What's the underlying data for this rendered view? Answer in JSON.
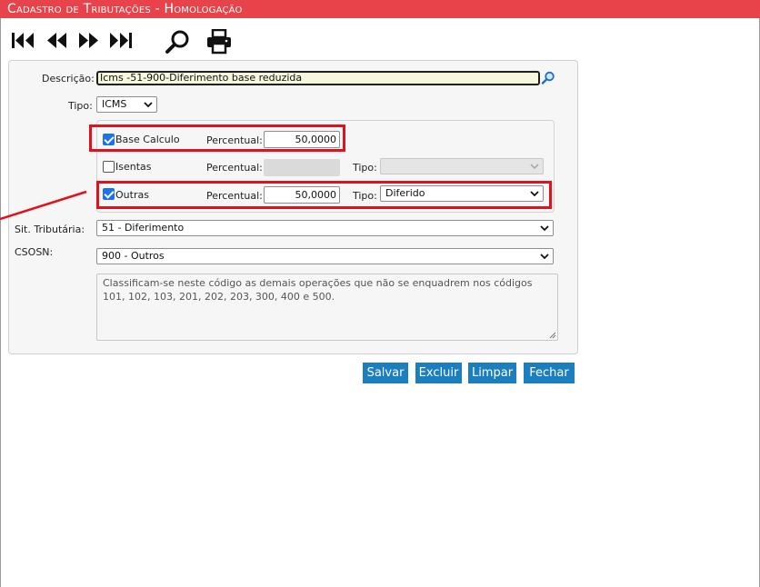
{
  "window": {
    "title": "Cadastro de Tributações  - Homologação"
  },
  "toolbar": {
    "first_icon": "first-record-icon",
    "prev_icon": "previous-record-icon",
    "next_icon": "next-record-icon",
    "last_icon": "last-record-icon",
    "search_icon": "search-icon",
    "print_icon": "print-icon"
  },
  "form": {
    "descricao_label": "Descrição:",
    "descricao_value": "Icms -51-900-Diferimento base reduzida",
    "tipo_label": "Tipo:",
    "tipo_value": "ICMS",
    "base_calculo": {
      "label": "Base Calculo",
      "checked": true,
      "percentual_label": "Percentual:",
      "percentual_value": "50,0000"
    },
    "isentas": {
      "label": "Isentas",
      "checked": false,
      "percentual_label": "Percentual:",
      "percentual_value": "",
      "tipo_label": "Tipo:",
      "tipo_value": ""
    },
    "outras": {
      "label": "Outras",
      "checked": true,
      "percentual_label": "Percentual:",
      "percentual_value": "50,0000",
      "tipo_label": "Tipo:",
      "tipo_value": "Diferido"
    },
    "sit_tributaria_label": "Sit. Tributária:",
    "sit_tributaria_value": "51 - Diferimento",
    "csosn_label": "CSOSN:",
    "csosn_value": "900 - Outros",
    "observacao": "Classificam-se neste código as demais operações que não se enquadrem nos códigos 101, 102, 103, 201, 202, 203, 300, 400 e 500."
  },
  "buttons": {
    "salvar": "Salvar",
    "excluir": "Excluir",
    "limpar": "Limpar",
    "fechar": "Fechar"
  },
  "colors": {
    "title_bar": "#e8434b",
    "button": "#1a7ebf",
    "highlight": "#e0121c",
    "checkbox": "#1a73e8"
  }
}
